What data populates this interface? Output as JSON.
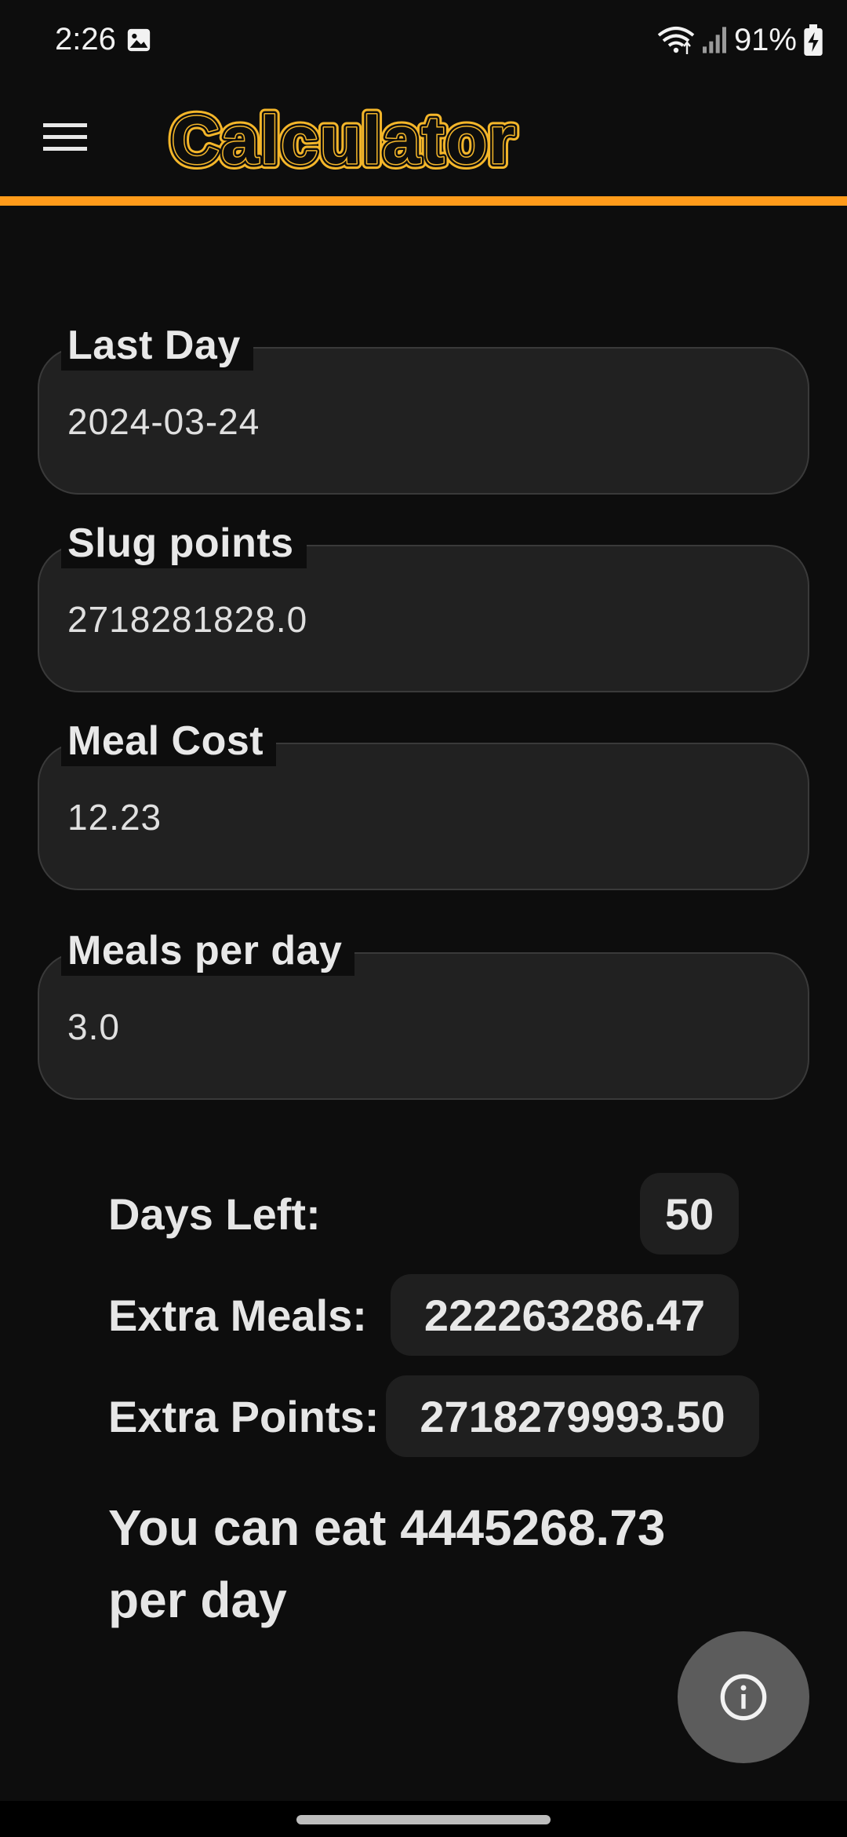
{
  "status_bar": {
    "time": "2:26",
    "battery": "91%"
  },
  "app_bar": {
    "title": "Calculator",
    "accent_color": "#ff9b1a",
    "title_color": "#f4b62a"
  },
  "fields": [
    {
      "label": "Last Day",
      "value": "2024-03-24"
    },
    {
      "label": "Slug points",
      "value": "2718281828.0"
    },
    {
      "label": "Meal Cost",
      "value": "12.23"
    },
    {
      "label": "Meals per day",
      "value": "3.0"
    }
  ],
  "results": {
    "days_left": {
      "label": "Days Left:",
      "value": "50"
    },
    "extra_meals": {
      "label": "Extra Meals:",
      "value": "222263286.47"
    },
    "extra_points": {
      "label": "Extra Points:",
      "value": "2718279993.50"
    }
  },
  "summary": "You can eat 4445268.73 per day",
  "icons": {
    "menu": "hamburger-menu-icon",
    "info": "info-icon",
    "gallery": "image-icon",
    "wifi": "wifi-icon",
    "signal": "signal-icon",
    "battery": "battery-charging-icon"
  }
}
